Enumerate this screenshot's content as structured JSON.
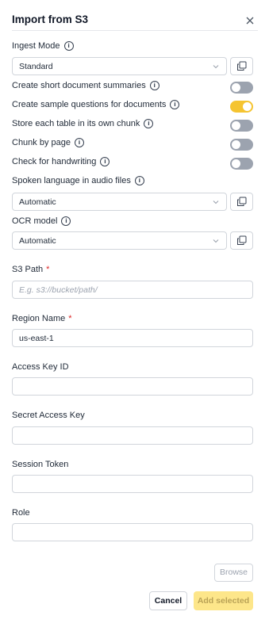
{
  "dialog": {
    "title": "Import from S3"
  },
  "ingest_mode": {
    "label": "Ingest Mode",
    "value": "Standard"
  },
  "toggles": [
    {
      "label": "Create short document summaries",
      "on": false
    },
    {
      "label": "Create sample questions for documents",
      "on": true
    },
    {
      "label": "Store each table in its own chunk",
      "on": false
    },
    {
      "label": "Chunk by page",
      "on": false
    },
    {
      "label": "Check for handwriting",
      "on": false
    }
  ],
  "spoken_language": {
    "label": "Spoken language in audio files",
    "value": "Automatic"
  },
  "ocr_model": {
    "label": "OCR model",
    "value": "Automatic"
  },
  "fields": {
    "s3_path": {
      "label": "S3 Path",
      "required_mark": "*",
      "placeholder": "E.g. s3://bucket/path/",
      "value": ""
    },
    "region_name": {
      "label": "Region Name",
      "required_mark": "*",
      "value": "us-east-1"
    },
    "access_key_id": {
      "label": "Access Key ID",
      "value": ""
    },
    "secret_access_key": {
      "label": "Secret Access Key",
      "value": ""
    },
    "session_token": {
      "label": "Session Token",
      "value": ""
    },
    "role": {
      "label": "Role",
      "value": ""
    }
  },
  "buttons": {
    "browse": "Browse",
    "cancel": "Cancel",
    "add_selected": "Add selected"
  },
  "colors": {
    "toggle_on": "#f5c431",
    "toggle_off": "#9ca3af",
    "primary_disabled": "#fde68a",
    "required": "#dc2626"
  },
  "icons": {
    "close": "close-icon",
    "info": "info-icon",
    "chevron": "chevron-down-icon",
    "copy": "copy-icon"
  }
}
